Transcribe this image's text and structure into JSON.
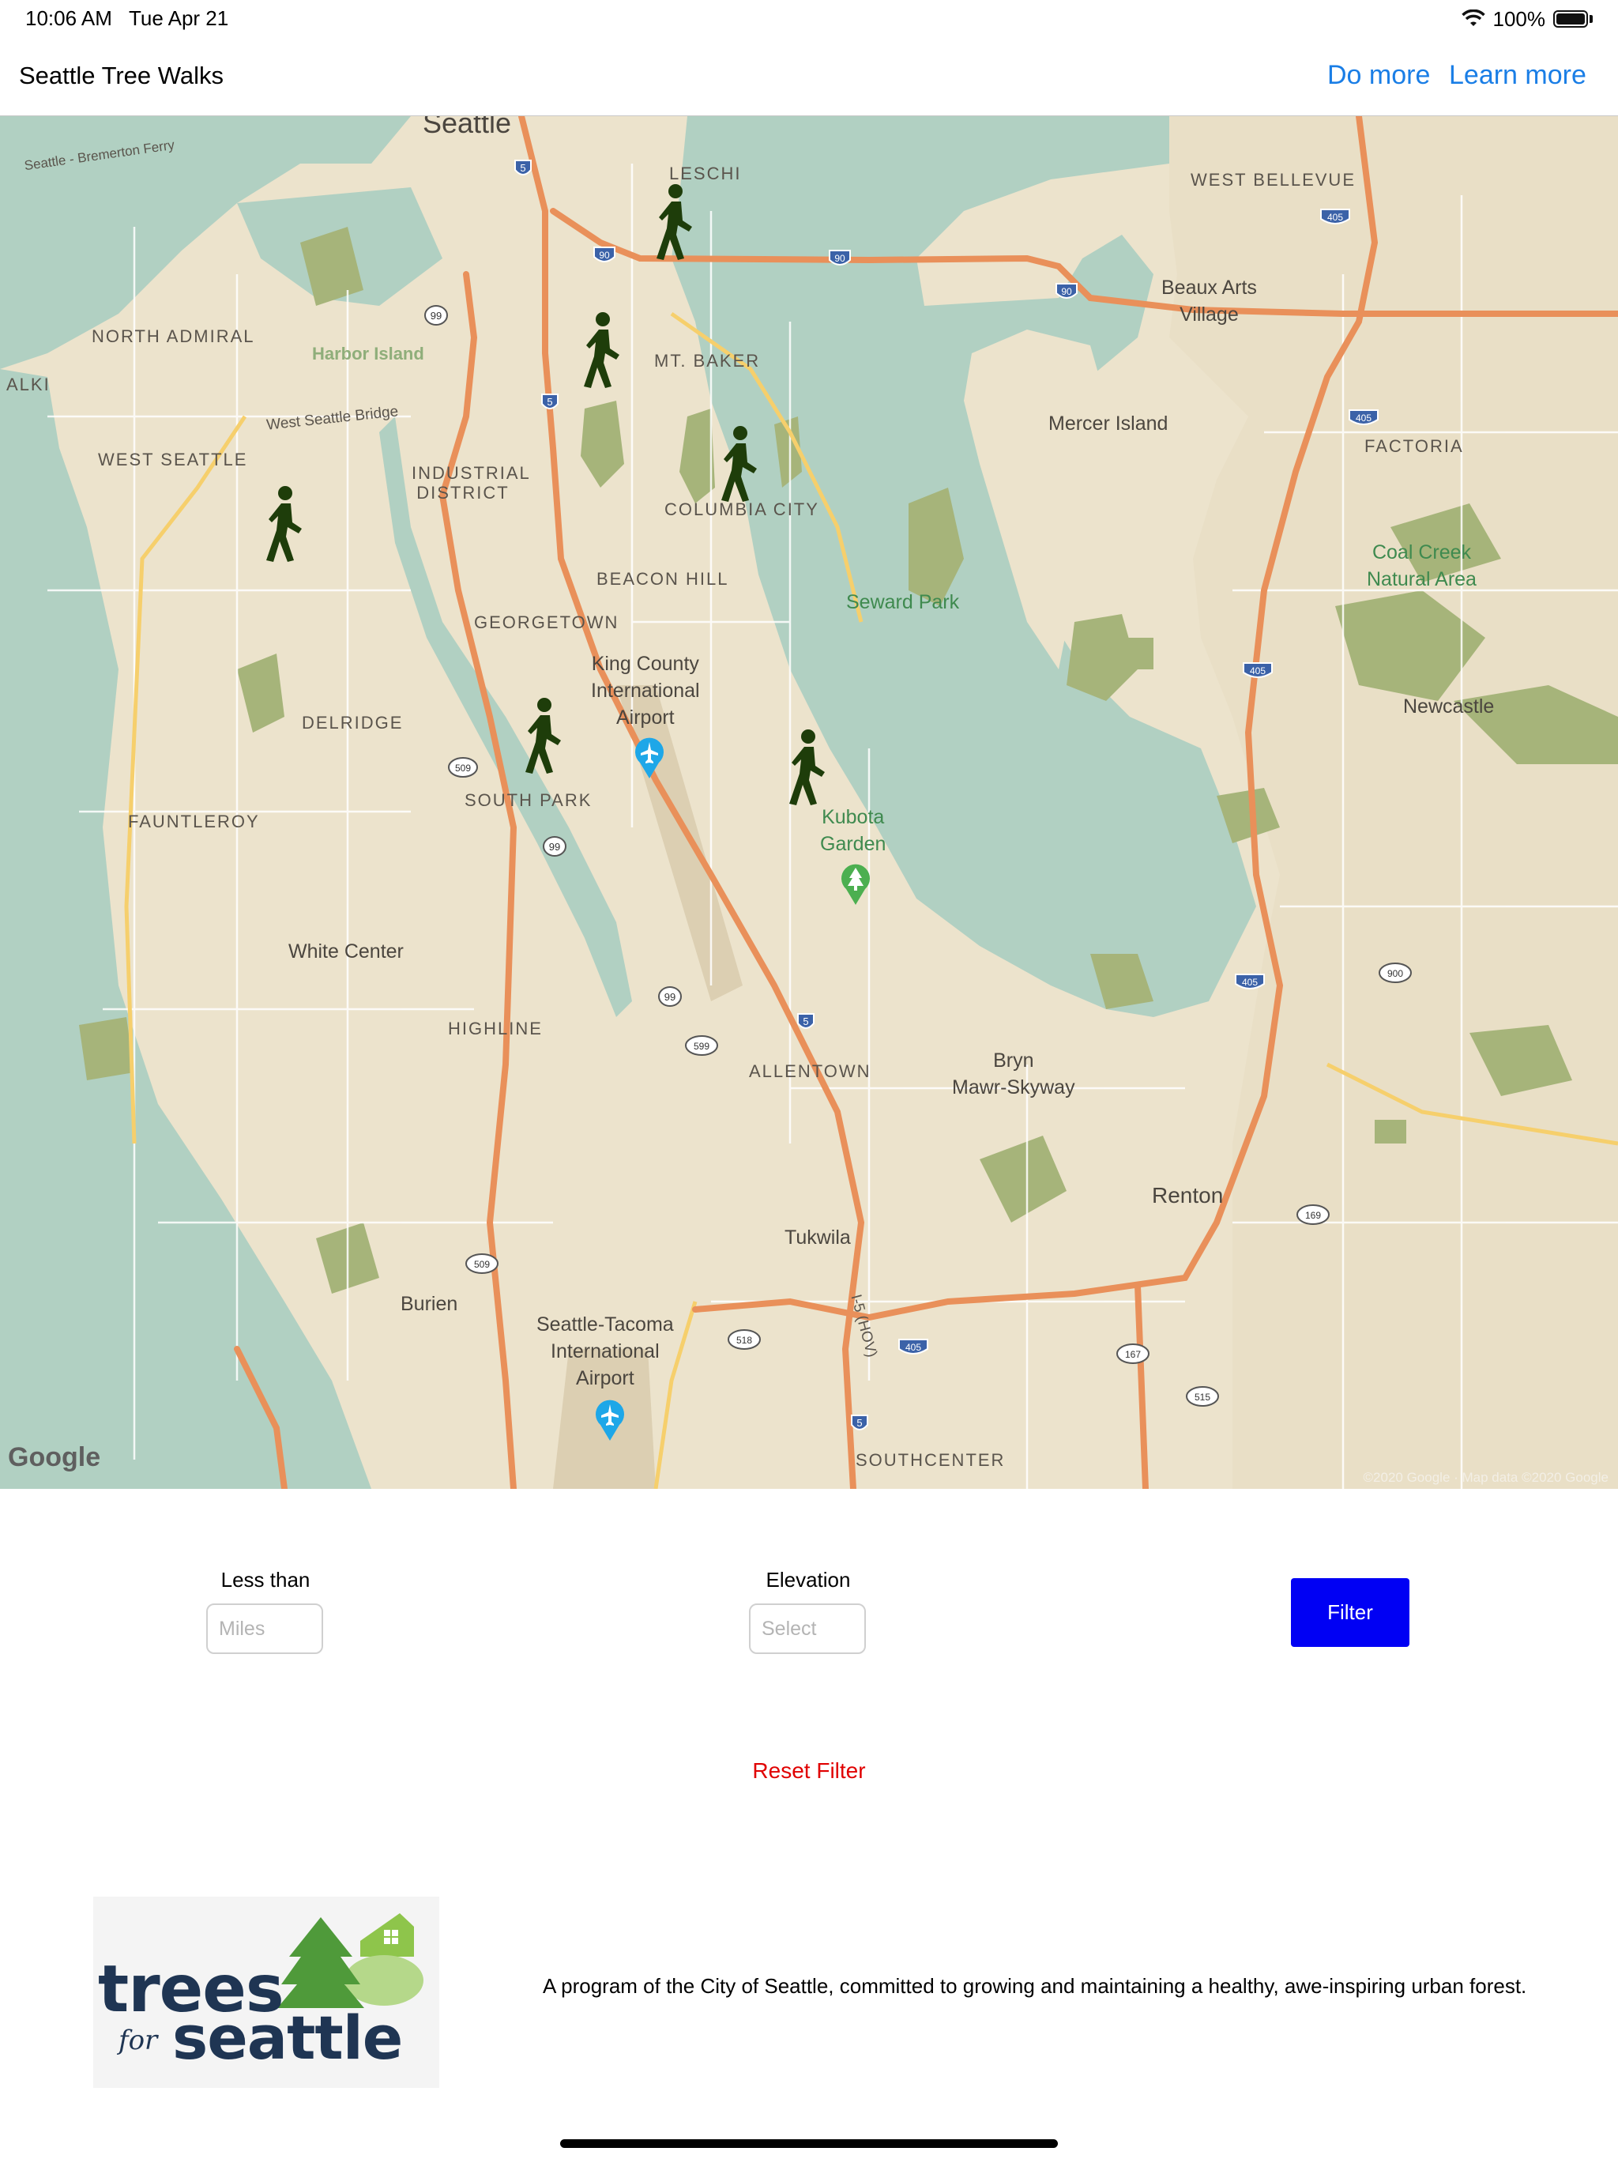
{
  "status_bar": {
    "time": "10:06 AM",
    "date": "Tue Apr 21",
    "battery": "100%"
  },
  "nav": {
    "title": "Seattle Tree Walks",
    "do_more": "Do more",
    "learn_more": "Learn more"
  },
  "map": {
    "neighborhoods": [
      "LESCHI",
      "WEST BELLEVUE",
      "NORTH ADMIRAL",
      "ALKI",
      "MT. BAKER",
      "FACTORIA",
      "WEST SEATTLE",
      "INDUSTRIAL DISTRICT",
      "COLUMBIA CITY",
      "BEACON HILL",
      "GEORGETOWN",
      "DELRIDGE",
      "SOUTH PARK",
      "FAUNTLEROY",
      "HIGHLINE",
      "ALLENTOWN",
      "SOUTHCENTER"
    ],
    "cities": {
      "seattle": "Seattle",
      "beaux_arts_1": "Beaux Arts",
      "beaux_arts_2": "Village",
      "mercer_island": "Mercer Island",
      "newcastle": "Newcastle",
      "white_center": "White Center",
      "bryn_1": "Bryn",
      "bryn_2": "Mawr-Skyway",
      "renton": "Renton",
      "tukwila": "Tukwila",
      "burien": "Burien",
      "kc_airport_1": "King County",
      "kc_airport_2": "International",
      "kc_airport_3": "Airport",
      "sea_tac_1": "Seattle-Tacoma",
      "sea_tac_2": "International",
      "sea_tac_3": "Airport",
      "ferry": "Seattle - Bremerton Ferry",
      "harbor_island": "Harbor Island",
      "wsb": "West Seattle Bridge",
      "i5_hov": "I-5 (HOV)"
    },
    "parks": {
      "seward_park": "Seward Park",
      "coal_creek_1": "Coal Creek",
      "coal_creek_2": "Natural Area",
      "kubota_1": "Kubota",
      "kubota_2": "Garden"
    },
    "route_shields": [
      "5",
      "90",
      "99",
      "90",
      "90",
      "405",
      "405",
      "5",
      "405",
      "509",
      "99",
      "405",
      "900",
      "99",
      "599",
      "5",
      "169",
      "509",
      "518",
      "405",
      "167",
      "515",
      "5"
    ],
    "walk_markers": 6,
    "google": "Google",
    "attribution": "©2020 Google · Map data ©2020 Google"
  },
  "filters": {
    "distance_label": "Less than",
    "distance_placeholder": "Miles",
    "elevation_label": "Elevation",
    "elevation_placeholder": "Select",
    "filter_button": "Filter",
    "reset": "Reset Filter"
  },
  "footer": {
    "logo_text": [
      "trees",
      "for",
      "seattle"
    ],
    "tagline": "A program of the City of Seattle, committed to growing and maintaining a healthy, awe-inspiring urban forest."
  },
  "colors": {
    "accent_blue": "#1a7ee6",
    "filter_button": "#0000f4",
    "reset_red": "#e00000",
    "walker_green": "#1e3d0a",
    "water": "#b1d0c2",
    "land": "#ece3cc"
  }
}
